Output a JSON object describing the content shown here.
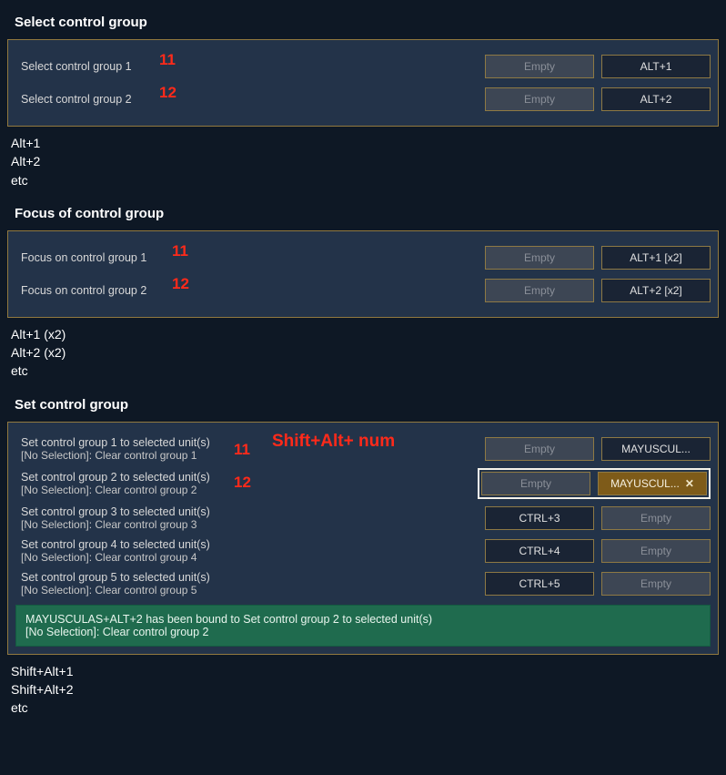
{
  "sections": {
    "select": {
      "title": "Select control group",
      "rows": [
        {
          "label": "Select control group 1",
          "slot0": "Empty",
          "slot1": "ALT+1",
          "annot": "11"
        },
        {
          "label": "Select control group 2",
          "slot0": "Empty",
          "slot1": "ALT+2",
          "annot": "12"
        }
      ],
      "below": [
        "Alt+1",
        "Alt+2",
        "etc"
      ]
    },
    "focus": {
      "title": "Focus of control group",
      "rows": [
        {
          "label": "Focus on control group 1",
          "slot0": "Empty",
          "slot1": "ALT+1 [x2]",
          "annot": "11"
        },
        {
          "label": "Focus on control group 2",
          "slot0": "Empty",
          "slot1": "ALT+2 [x2]",
          "annot": "12"
        }
      ],
      "below": [
        "Alt+1 (x2)",
        "Alt+2 (x2)",
        "etc"
      ]
    },
    "set": {
      "title": "Set control group",
      "annot_big": "Shift+Alt+ num",
      "rows": [
        {
          "label": "Set control group 1 to selected unit(s)",
          "sub": "[No Selection]: Clear control group 1",
          "slot0": "Empty",
          "slot1": "MAYUSCUL...",
          "annot": "11",
          "slot0class": "empty",
          "slot1class": "assigned"
        },
        {
          "label": "Set control group 2 to selected unit(s)",
          "sub": "[No Selection]: Clear control group 2",
          "slot0": "Empty",
          "slot1": "MAYUSCUL...",
          "annot": "12",
          "slot0class": "empty",
          "slot1class": "active",
          "activeRow": true
        },
        {
          "label": "Set control group 3 to selected unit(s)",
          "sub": "[No Selection]: Clear control group 3",
          "slot0": "CTRL+3",
          "slot1": "Empty",
          "slot0class": "assigned",
          "slot1class": "empty"
        },
        {
          "label": "Set control group 4 to selected unit(s)",
          "sub": "[No Selection]: Clear control group 4",
          "slot0": "CTRL+4",
          "slot1": "Empty",
          "slot0class": "assigned",
          "slot1class": "empty"
        },
        {
          "label": "Set control group 5 to selected unit(s)",
          "sub": "[No Selection]: Clear control group 5",
          "slot0": "CTRL+5",
          "slot1": "Empty",
          "slot0class": "assigned",
          "slot1class": "empty"
        }
      ],
      "notice_line1": "MAYUSCULAS+ALT+2 has been bound to Set control group 2 to selected unit(s)",
      "notice_line2": "[No Selection]: Clear control group 2",
      "below": [
        "Shift+Alt+1",
        "Shift+Alt+2",
        "etc"
      ]
    }
  },
  "close_glyph": "✕"
}
